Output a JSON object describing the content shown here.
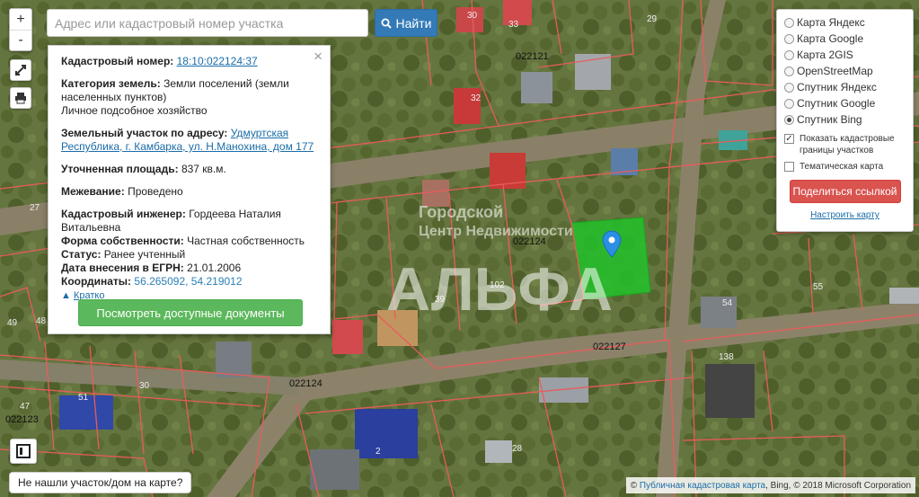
{
  "search": {
    "placeholder": "Адрес или кадастровый номер участка",
    "button_label": "Найти"
  },
  "zoom": {
    "in_label": "+",
    "out_label": "-"
  },
  "info": {
    "cadastral_label": "Кадастровый номер:",
    "cadastral_value": "18:10:022124:37",
    "category_label": "Категория земель:",
    "category_value": "Земли поселений (земли населенных пунктов)",
    "use_value": "Личное подсобное хозяйство",
    "address_label": "Земельный участок по адресу:",
    "address_value": "Удмуртская Республика, г. Камбарка, ул. Н.Манохина, дом 177",
    "area_label": "Уточненная площадь:",
    "area_value": "837 кв.м.",
    "survey_label": "Межевание:",
    "survey_value": "Проведено",
    "engineer_label": "Кадастровый инженер:",
    "engineer_value": "Гордеева Наталия Витальевна",
    "ownership_label": "Форма собственности:",
    "ownership_value": "Частная собственность",
    "status_label": "Статус:",
    "status_value": "Ранее учтенный",
    "egrn_label": "Дата внесения в ЕГРН:",
    "egrn_value": "21.01.2006",
    "coords_label": "Координаты:",
    "coords_value": "56.265092, 54.219012",
    "brief_label": "Кратко",
    "docs_button": "Посмотреть доступные документы"
  },
  "layers": {
    "options": [
      {
        "label": "Карта Яндекс",
        "selected": false
      },
      {
        "label": "Карта Google",
        "selected": false
      },
      {
        "label": "Карта 2GIS",
        "selected": false
      },
      {
        "label": "OpenStreetMap",
        "selected": false
      },
      {
        "label": "Спутник Яндекс",
        "selected": false
      },
      {
        "label": "Спутник Google",
        "selected": false
      },
      {
        "label": "Спутник Bing",
        "selected": true
      }
    ],
    "show_boundaries": "Показать кадастровые границы участков",
    "show_boundaries_checked": true,
    "thematic": "Тематическая карта",
    "thematic_checked": false,
    "share_button": "Поделиться ссылкой",
    "setup_link": "Настроить карту"
  },
  "map": {
    "quarters": [
      "022121",
      "022124",
      "022127",
      "022124",
      "022123"
    ],
    "house_numbers": [
      "32",
      "30",
      "33",
      "29",
      "27",
      "39",
      "102",
      "54",
      "55",
      "138",
      "49",
      "48",
      "47",
      "51",
      "30",
      "2",
      "28"
    ],
    "watermark_line1": "Городской",
    "watermark_line2": "Центр Недвижимости",
    "watermark_logo": "АЛЬФА"
  },
  "footer": {
    "not_found": "Не нашли участок/дом на карте?",
    "attrib_prefix": "©",
    "attrib_link": "Публичная кадастровая карта",
    "attrib_suffix": ", Bing, © 2018 Microsoft Corporation"
  },
  "colors": {
    "parcel_highlight": "#22c22a",
    "boundary": "#d9534f",
    "primary": "#337ab7",
    "success": "#5cb85c",
    "danger": "#d9534f"
  },
  "icons": [
    "search-icon",
    "fullscreen-icon",
    "print-icon",
    "map-pin-icon",
    "layers-toggle-icon",
    "close-icon",
    "caret-up-icon"
  ]
}
